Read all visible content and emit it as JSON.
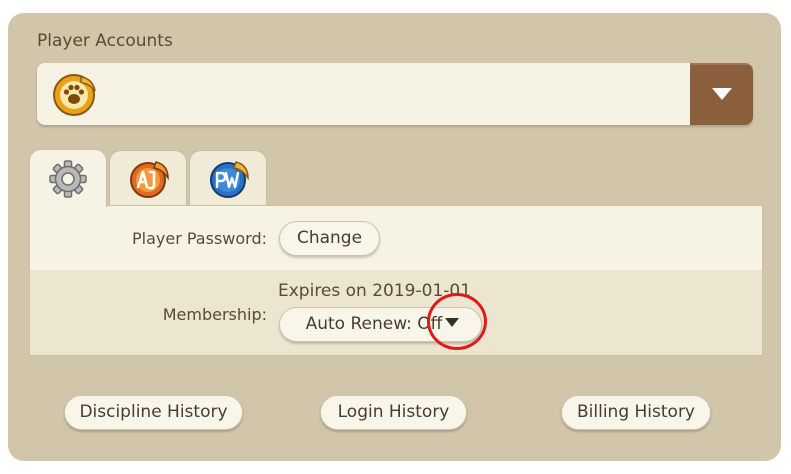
{
  "panel": {
    "title": "Player Accounts"
  },
  "account_select": {
    "avatar_icon": "paw-badge-icon",
    "dropdown_icon": "triangle-down-icon"
  },
  "tabs": [
    {
      "icon": "gear-icon",
      "active": true
    },
    {
      "icon": "animal-jam-logo-icon",
      "active": false
    },
    {
      "icon": "play-wild-logo-icon",
      "active": false
    }
  ],
  "settings": {
    "password_label": "Player Password:",
    "change_button": "Change",
    "membership_label": "Membership:",
    "expires_text": "Expires on 2019-01-01",
    "auto_renew_label": "Auto Renew: Off"
  },
  "footer": {
    "discipline_history": "Discipline History",
    "login_history": "Login History",
    "billing_history": "Billing History"
  },
  "colors": {
    "panel_bg": "#d1c6aa",
    "content_bg": "#f6f3e5",
    "dropdown_button": "#8b5e3c",
    "annotation_circle": "#e11919"
  }
}
